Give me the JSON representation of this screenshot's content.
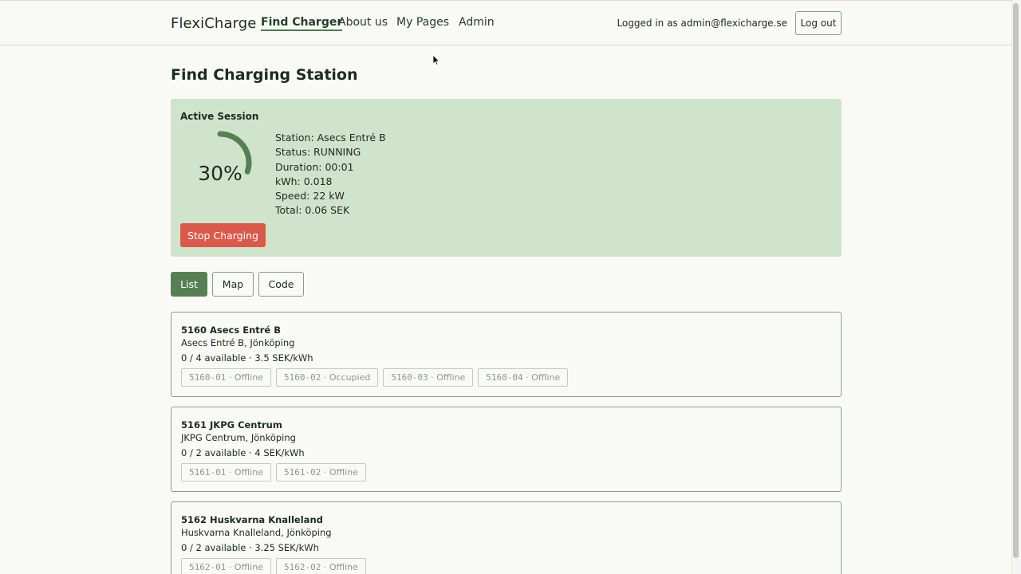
{
  "nav": {
    "brand": "FlexiCharge",
    "links": [
      "Find Charger",
      "About us",
      "My Pages",
      "Admin"
    ],
    "logged_in_text": "Logged in as admin@flexicharge.se",
    "logout_label": "Log out"
  },
  "page_title": "Find Charging Station",
  "session": {
    "heading": "Active Session",
    "progress_percent": 30,
    "progress_label": "30%",
    "lines": [
      "Station: Asecs Entré B",
      "Status: RUNNING",
      "Duration: 00:01",
      "kWh: 0.018",
      "Speed: 22 kW",
      "Total: 0.06 SEK"
    ],
    "stop_label": "Stop Charging"
  },
  "tabs": [
    "List",
    "Map",
    "Code"
  ],
  "stations": [
    {
      "title": "5160 Asecs Entré B",
      "address": "Asecs Entré B, Jönköping",
      "availability": "0 / 4 available · 3.5 SEK/kWh",
      "connectors": [
        {
          "id": "5160-01",
          "status": "Offline"
        },
        {
          "id": "5160-02",
          "status": "Occupied"
        },
        {
          "id": "5160-03",
          "status": "Offline"
        },
        {
          "id": "5160-04",
          "status": "Offline"
        }
      ]
    },
    {
      "title": "5161 JKPG Centrum",
      "address": "JKPG Centrum, Jönköping",
      "availability": "0 / 2 available · 4 SEK/kWh",
      "connectors": [
        {
          "id": "5161-01",
          "status": "Offline"
        },
        {
          "id": "5161-02",
          "status": "Offline"
        }
      ]
    },
    {
      "title": "5162 Huskvarna Knalleland",
      "address": "Huskvarna Knalleland, Jönköping",
      "availability": "0 / 2 available · 3.25 SEK/kWh",
      "connectors": [
        {
          "id": "5162-01",
          "status": "Offline"
        },
        {
          "id": "5162-02",
          "status": "Offline"
        }
      ]
    }
  ],
  "colors": {
    "accent": "#567f56",
    "session_bg": "#d0e3cb",
    "stop": "#d9594a",
    "gauge": "#567f56"
  }
}
